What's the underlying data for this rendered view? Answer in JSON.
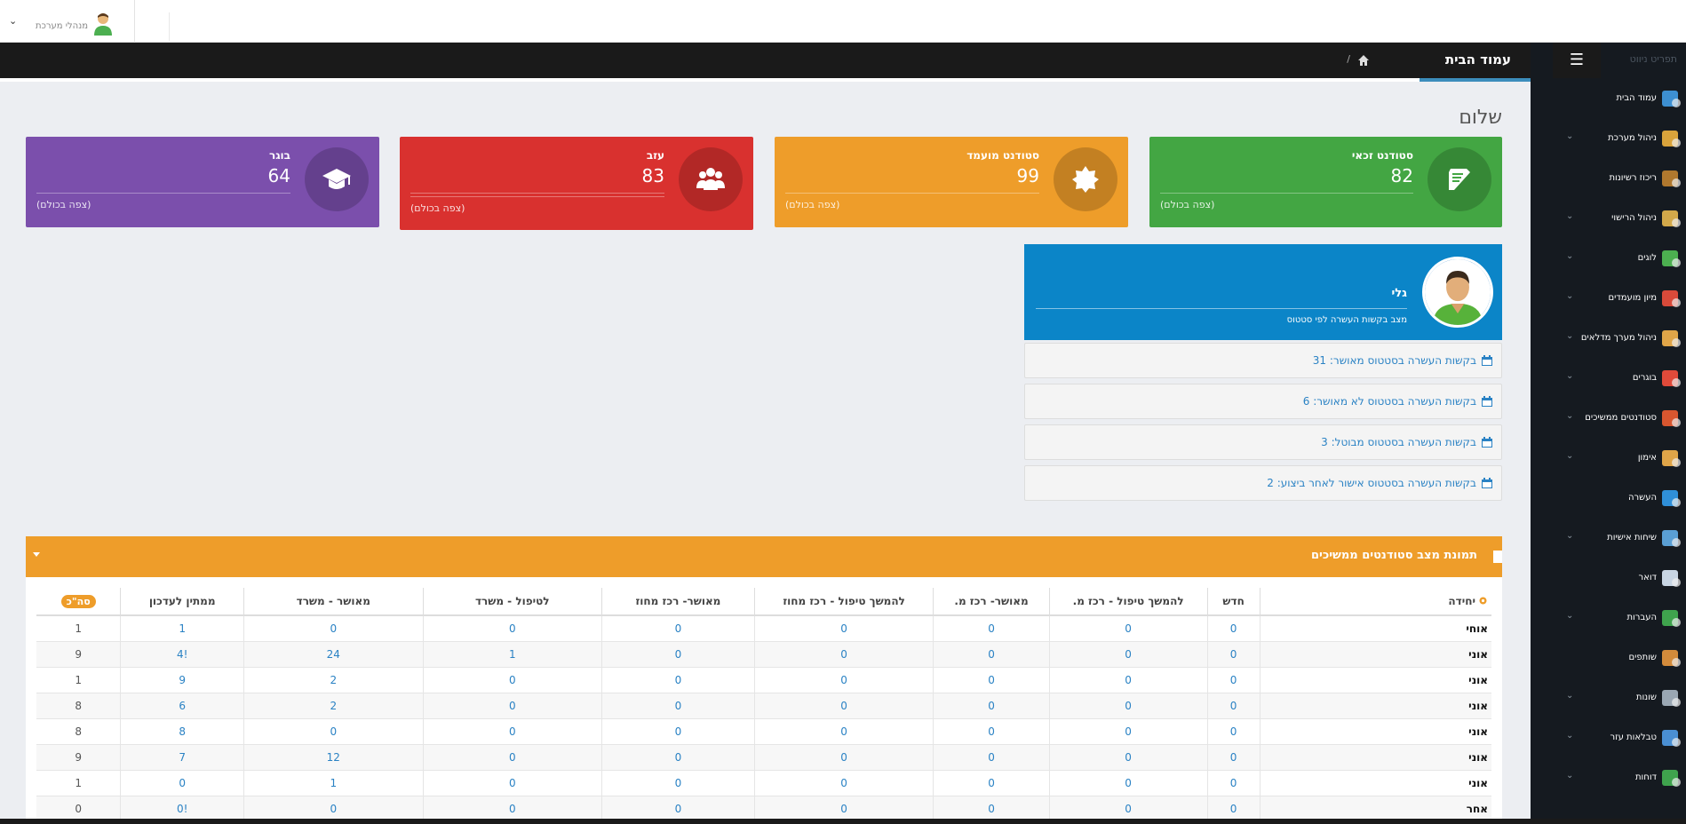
{
  "topbar": {
    "user_label": "מנהלי מערכת"
  },
  "header": {
    "title": "עמוד הבית",
    "separator": "/"
  },
  "sidebar": {
    "title": "תפריט ניווט",
    "items": [
      {
        "label": "עמוד הבית",
        "icon": "home-monitor-icon",
        "has_children": false
      },
      {
        "label": "ניהול מערכת",
        "icon": "gears-icon",
        "has_children": true
      },
      {
        "label": "ריכוז רשיונות",
        "icon": "books-icon",
        "has_children": false
      },
      {
        "label": "ניהול הרישוי",
        "icon": "certificate-icon",
        "has_children": true
      },
      {
        "label": "לוגים",
        "icon": "clock-icon",
        "has_children": true
      },
      {
        "label": "מיון מועמדים",
        "icon": "users-icon",
        "has_children": true
      },
      {
        "label": "ניהול מערך מדלאים",
        "icon": "team-icon",
        "has_children": true
      },
      {
        "label": "בוגרים",
        "icon": "graduates-icon",
        "has_children": true
      },
      {
        "label": "סטודנטים ממשיכים",
        "icon": "students-icon",
        "has_children": true
      },
      {
        "label": "אימון",
        "icon": "trainer-icon",
        "has_children": true
      },
      {
        "label": "העשרה",
        "icon": "refresh-icon",
        "has_children": false
      },
      {
        "label": "שיחות אישיות",
        "icon": "conversation-icon",
        "has_children": true
      },
      {
        "label": "דואר",
        "icon": "mail-icon",
        "has_children": false
      },
      {
        "label": "העברות",
        "icon": "transfer-icon",
        "has_children": true
      },
      {
        "label": "שותפים",
        "icon": "handshake-icon",
        "has_children": false
      },
      {
        "label": "שונות",
        "icon": "misc-gears-icon",
        "has_children": true
      },
      {
        "label": "טבלאות עזר",
        "icon": "chart-icon",
        "has_children": true
      },
      {
        "label": "דוחות",
        "icon": "report-icon",
        "has_children": true
      }
    ]
  },
  "page": {
    "greeting": "שלום"
  },
  "stats": [
    {
      "title": "סטודנט זכאי",
      "value": "82",
      "link": "(צפה בכולם)",
      "color": "#43a643",
      "icon": "book-icon"
    },
    {
      "title": "סטודנט מועמד",
      "value": "99",
      "link": "(צפה בכולם)",
      "color": "#ee9d2a",
      "icon": "badge-icon"
    },
    {
      "title": "עזב",
      "value": "83",
      "link": "(צפה בכולם)",
      "color": "#d9312f",
      "icon": "users-icon"
    },
    {
      "title": "בוגר",
      "value": "64",
      "link": "(צפה בכולם)",
      "color": "#7b4fac",
      "icon": "graduation-cap-icon"
    }
  ],
  "profile": {
    "name": "גלי",
    "subtitle": "מצב בקשות העשרה לפי סטטוס",
    "color": "#0b85c8"
  },
  "requests": [
    {
      "text": "בקשות העשרה בסטטוס מאושר: 31"
    },
    {
      "text": "בקשות העשרה בסטטוס לא מאושר: 6"
    },
    {
      "text": "בקשות העשרה בסטטוס מבוטל:  3"
    },
    {
      "text": "בקשות העשרה בסטטוס אישור לאחר ביצוע: 2"
    }
  ],
  "table": {
    "title": "תמונת מצב סטודנטים ממשיכים",
    "headers": [
      "יחידה",
      "חדש",
      "להמשך טיפול - רכז מ.",
      "מאושר- רכז מ.",
      "להמשך טיפול - רכז מחוז",
      "מאושר- רכז מחוז",
      "לטיפול - משרד",
      "מאושר - משרד",
      "ממתין לעדכון",
      "סה\"כ"
    ],
    "rows": [
      [
        "אוחי",
        "0",
        "0",
        "0",
        "0",
        "0",
        "0",
        "0",
        "1",
        "1"
      ],
      [
        "אוני",
        "0",
        "0",
        "0",
        "0",
        "0",
        "1",
        "24",
        "!4",
        "9"
      ],
      [
        "אוני",
        "0",
        "0",
        "0",
        "0",
        "0",
        "0",
        "2",
        "9",
        "1"
      ],
      [
        "אוני",
        "0",
        "0",
        "0",
        "0",
        "0",
        "0",
        "2",
        "6",
        "8"
      ],
      [
        "אוני",
        "0",
        "0",
        "0",
        "0",
        "0",
        "0",
        "0",
        "8",
        "8"
      ],
      [
        "אוני",
        "0",
        "0",
        "0",
        "0",
        "0",
        "0",
        "12",
        "7",
        "9"
      ],
      [
        "אוני",
        "0",
        "0",
        "0",
        "0",
        "0",
        "0",
        "1",
        "0",
        "1"
      ],
      [
        "אחר",
        "0",
        "0",
        "0",
        "0",
        "0",
        "0",
        "0",
        "!0",
        "0"
      ]
    ]
  }
}
